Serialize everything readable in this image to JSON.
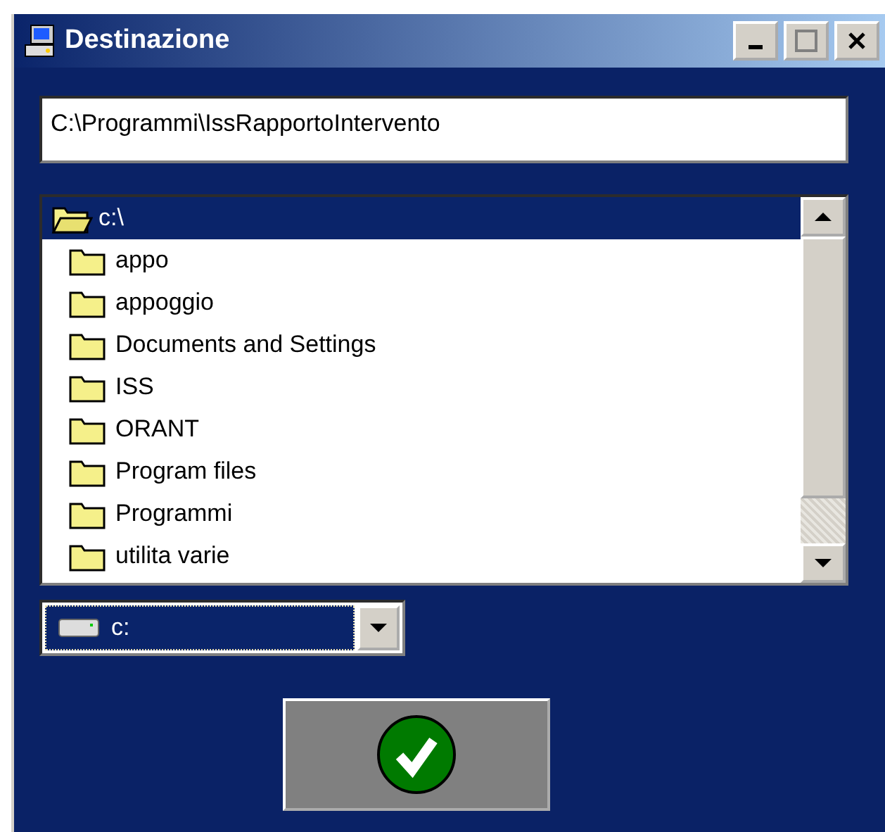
{
  "window": {
    "title": "Destinazione"
  },
  "path_field": {
    "value": "C:\\Programmi\\IssRapportoIntervento"
  },
  "folders": {
    "root": {
      "label": "c:\\",
      "selected": true,
      "children": [
        {
          "label": "appo",
          "selected": false
        },
        {
          "label": "appoggio",
          "selected": false
        },
        {
          "label": "Documents and Settings",
          "selected": false
        },
        {
          "label": "ISS",
          "selected": false
        },
        {
          "label": "ORANT",
          "selected": false
        },
        {
          "label": "Program files",
          "selected": false
        },
        {
          "label": "Programmi",
          "selected": false
        },
        {
          "label": "utilita varie",
          "selected": false
        }
      ]
    }
  },
  "drive_select": {
    "value": "c:"
  }
}
